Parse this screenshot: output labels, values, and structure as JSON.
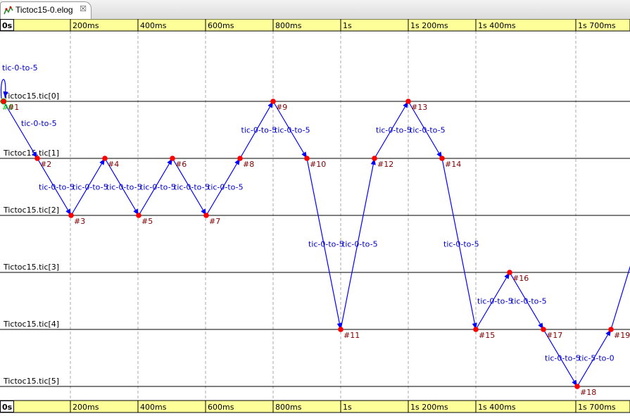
{
  "tab": {
    "title": "Tictoc15-0.elog",
    "close_symbol": "☒",
    "icon": "event-log-icon"
  },
  "colors": {
    "ruler_bg": "#ffff99",
    "message_arrow": "#0000ff",
    "message_label": "#0000cc",
    "event_dot": "#ff0000",
    "event_label": "#800000",
    "initial_event": "#00cc00",
    "axis_line": "#000000",
    "grid_line": "#aaaaaa"
  },
  "ruler": {
    "origin_label": "0s",
    "ticks": [
      "200ms",
      "400ms",
      "600ms",
      "800ms",
      "1s",
      "1s 200ms",
      "1s 400ms",
      "1s 700ms"
    ]
  },
  "axes": [
    "Tictoc15.tic[0]",
    "Tictoc15.tic[1]",
    "Tictoc15.tic[2]",
    "Tictoc15.tic[3]",
    "Tictoc15.tic[4]",
    "Tictoc15.tic[5]"
  ],
  "events": [
    {
      "label": "#0",
      "axis": 0,
      "slot": 0
    },
    {
      "label": "#1",
      "axis": 0,
      "slot": 0
    },
    {
      "label": "#2",
      "axis": 1,
      "slot": 1
    },
    {
      "label": "#3",
      "axis": 2,
      "slot": 2
    },
    {
      "label": "#4",
      "axis": 1,
      "slot": 3
    },
    {
      "label": "#5",
      "axis": 2,
      "slot": 4
    },
    {
      "label": "#6",
      "axis": 1,
      "slot": 5
    },
    {
      "label": "#7",
      "axis": 2,
      "slot": 6
    },
    {
      "label": "#8",
      "axis": 1,
      "slot": 7
    },
    {
      "label": "#9",
      "axis": 0,
      "slot": 8
    },
    {
      "label": "#10",
      "axis": 1,
      "slot": 9
    },
    {
      "label": "#11",
      "axis": 4,
      "slot": 10
    },
    {
      "label": "#12",
      "axis": 1,
      "slot": 11
    },
    {
      "label": "#13",
      "axis": 0,
      "slot": 12
    },
    {
      "label": "#14",
      "axis": 1,
      "slot": 13
    },
    {
      "label": "#15",
      "axis": 4,
      "slot": 14
    },
    {
      "label": "#16",
      "axis": 3,
      "slot": 15
    },
    {
      "label": "#17",
      "axis": 4,
      "slot": 16
    },
    {
      "label": "#18",
      "axis": 5,
      "slot": 17
    },
    {
      "label": "#19",
      "axis": 4,
      "slot": 18
    }
  ],
  "self_message": {
    "label": "tic-0-to-5"
  },
  "messages": [
    {
      "from": "#1",
      "to": "#2",
      "label": "tic-0-to-5"
    },
    {
      "from": "#2",
      "to": "#3",
      "label": "tic-0-to-5"
    },
    {
      "from": "#3",
      "to": "#4",
      "label": "tic-0-to-5"
    },
    {
      "from": "#4",
      "to": "#5",
      "label": "tic-0-to-5"
    },
    {
      "from": "#5",
      "to": "#6",
      "label": "tic-0-to-5"
    },
    {
      "from": "#6",
      "to": "#7",
      "label": "tic-0-to-5"
    },
    {
      "from": "#7",
      "to": "#8",
      "label": "tic-0-to-5"
    },
    {
      "from": "#8",
      "to": "#9",
      "label": "tic-0-to-5"
    },
    {
      "from": "#9",
      "to": "#10",
      "label": "tic-0-to-5"
    },
    {
      "from": "#10",
      "to": "#11",
      "label": "tic-0-to-5"
    },
    {
      "from": "#11",
      "to": "#12",
      "label": "tic-0-to-5"
    },
    {
      "from": "#12",
      "to": "#13",
      "label": "tic-0-to-5"
    },
    {
      "from": "#13",
      "to": "#14",
      "label": "tic-0-to-5"
    },
    {
      "from": "#14",
      "to": "#15",
      "label": "tic-0-to-5"
    },
    {
      "from": "#15",
      "to": "#16",
      "label": "tic-0-to-5"
    },
    {
      "from": "#16",
      "to": "#17",
      "label": "tic-0-to-5"
    },
    {
      "from": "#17",
      "to": "#18",
      "label": "tic-0-to-5"
    },
    {
      "from": "#18",
      "to": "#19",
      "label": "tic-5-to-0"
    },
    {
      "from": "#19",
      "to": null,
      "label": ""
    }
  ]
}
